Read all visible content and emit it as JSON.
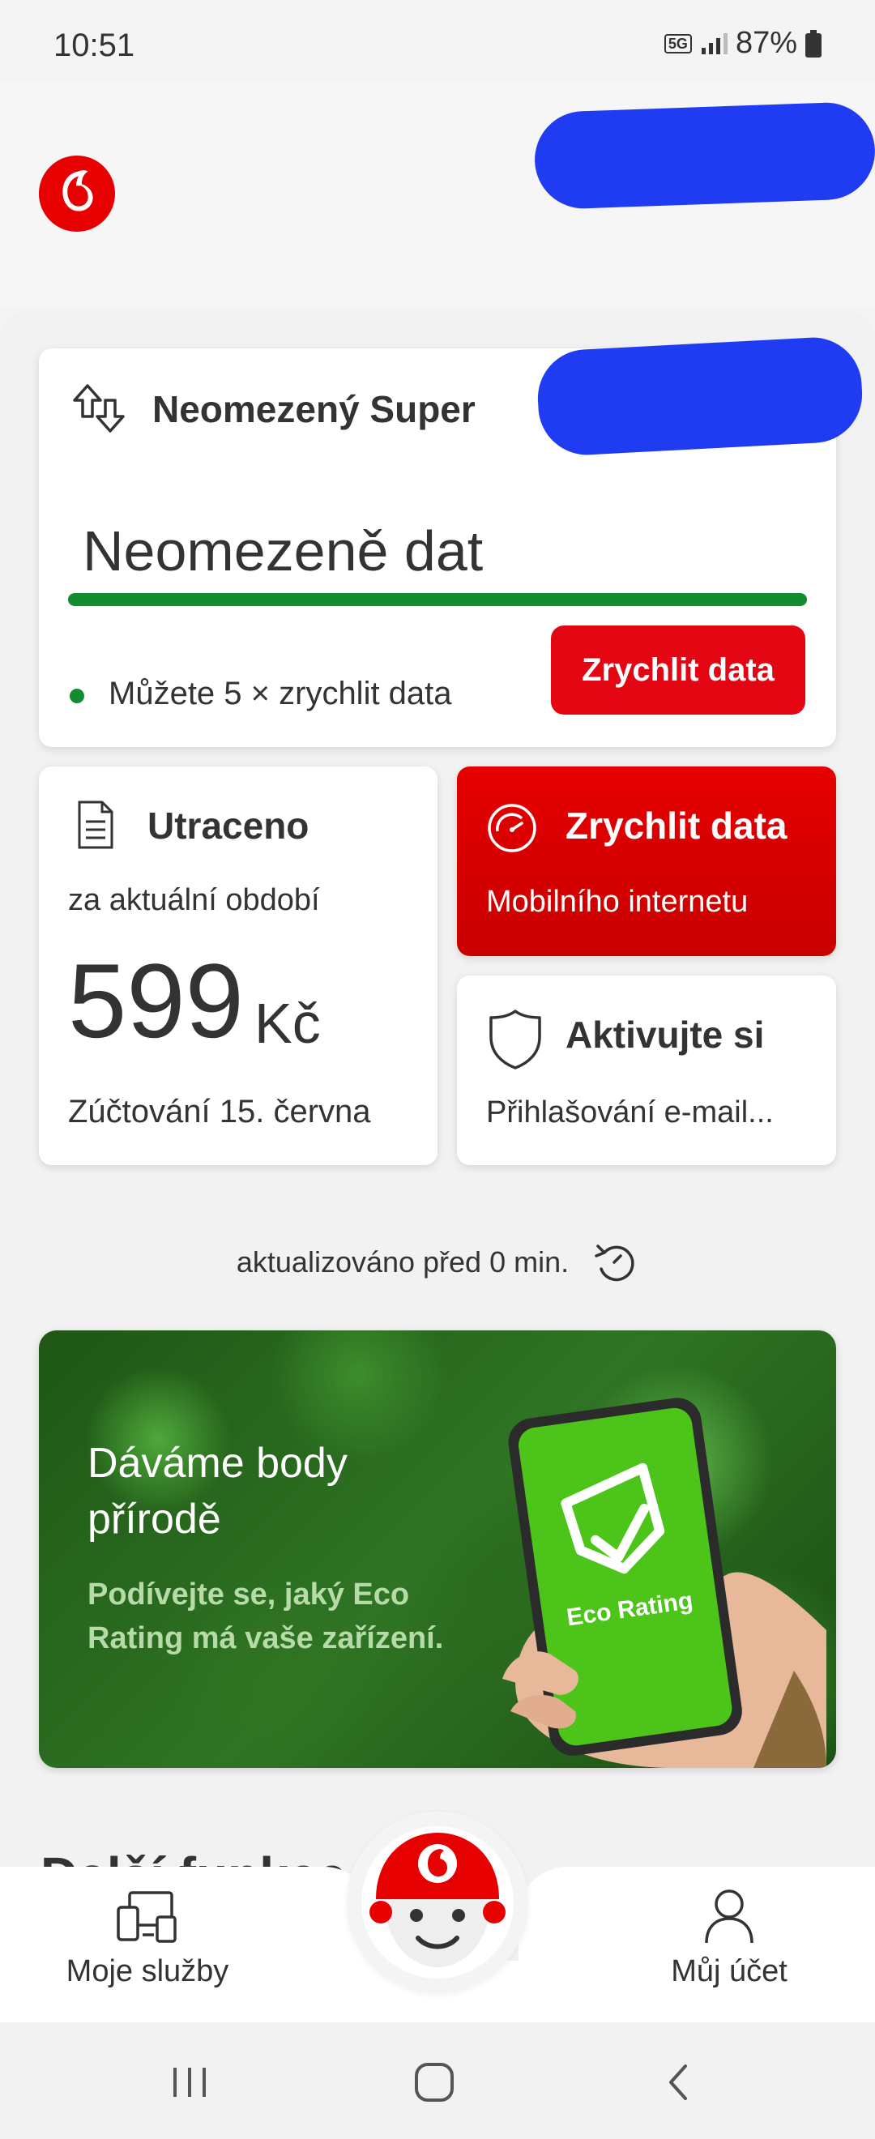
{
  "status_bar": {
    "time": "10:51",
    "network": "5G",
    "battery": "87%"
  },
  "plan": {
    "name": "Neomezený Super",
    "data_label": "Neomezeně dat",
    "usage_fraction": 1.0,
    "boosts_note": "Můžete 5 × zrychlit data",
    "boost_button": "Zrychlit data"
  },
  "spent": {
    "title": "Utraceno",
    "period": "za aktuální období",
    "amount": "599",
    "currency": "Kč",
    "billing": "Zúčtování 15. června"
  },
  "boost_tile": {
    "title": "Zrychlit data",
    "subtitle": "Mobilního internetu"
  },
  "activate_tile": {
    "title": "Aktivujte si",
    "subtitle": "Přihlašování e-mail..."
  },
  "updated": {
    "text": "aktualizováno před 0 min."
  },
  "banner": {
    "title": "Dáváme body přírodě",
    "subtitle": "Podívejte se, jaký Eco Rating má vaše zařízení.",
    "phone_label": "Eco Rating"
  },
  "section": {
    "title_partial": "Další funkce"
  },
  "bottom_nav": {
    "services": "Moje služby",
    "account": "Můj účet"
  },
  "colors": {
    "brand_red": "#e60000",
    "usage_green": "#148b2e",
    "redaction_blue": "#1f3cf2"
  }
}
